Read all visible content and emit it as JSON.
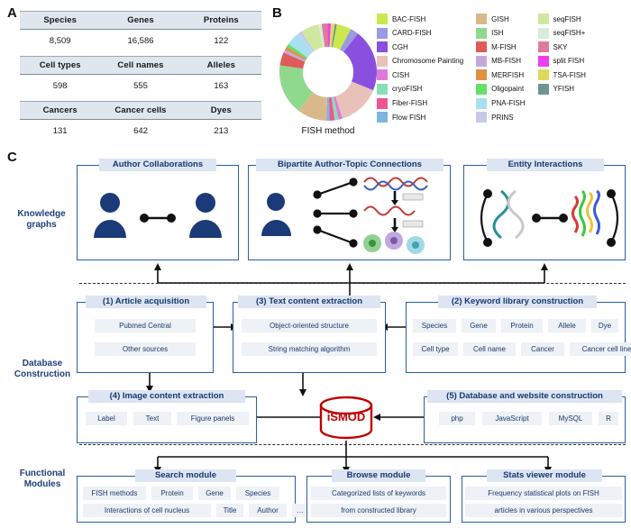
{
  "panels": {
    "a_letter": "A",
    "b_letter": "B",
    "c_letter": "C"
  },
  "panelA": {
    "blocks": [
      {
        "headers": [
          "Species",
          "Genes",
          "Proteins"
        ],
        "values": [
          "8,509",
          "16,586",
          "122"
        ]
      },
      {
        "headers": [
          "Cell types",
          "Cell names",
          "Alleles"
        ],
        "values": [
          "598",
          "555",
          "163"
        ]
      },
      {
        "headers": [
          "Cancers",
          "Cancer cells",
          "Dyes"
        ],
        "values": [
          "131",
          "642",
          "213"
        ]
      }
    ]
  },
  "panelB": {
    "caption": "FISH method",
    "legend_columns": [
      [
        {
          "label": "BAC-FISH",
          "color": "#cbe84e"
        },
        {
          "label": "CARD-FISH",
          "color": "#9a9ae0"
        },
        {
          "label": "CGH",
          "color": "#8b4fe0"
        },
        {
          "label": "Chromosome Painting",
          "color": "#e8c2b8"
        },
        {
          "label": "CISH",
          "color": "#e07ad8"
        },
        {
          "label": "cryoFISH",
          "color": "#86e0b4"
        },
        {
          "label": "Fiber-FISH",
          "color": "#ef5591"
        },
        {
          "label": "Flow FISH",
          "color": "#7fb4e0"
        }
      ],
      [
        {
          "label": "GISH",
          "color": "#d9b98a"
        },
        {
          "label": "ISH",
          "color": "#8ed98e"
        },
        {
          "label": "M-FISH",
          "color": "#e05a5a"
        },
        {
          "label": "MB-FISH",
          "color": "#c3a8e0"
        },
        {
          "label": "MERFISH",
          "color": "#e0913f"
        },
        {
          "label": "Oligopaint",
          "color": "#66e066"
        },
        {
          "label": "PNA-FISH",
          "color": "#a8e0ef"
        },
        {
          "label": "PRINS",
          "color": "#c8c8e8"
        }
      ],
      [
        {
          "label": "seqFISH",
          "color": "#cfe8a0"
        },
        {
          "label": "seqFISH+",
          "color": "#d8ecd8"
        },
        {
          "label": "SKY",
          "color": "#e07a9a"
        },
        {
          "label": "split FISH",
          "color": "#ef3fef"
        },
        {
          "label": "TSA-FISH",
          "color": "#e0d95a"
        },
        {
          "label": "YFISH",
          "color": "#6e9494"
        }
      ]
    ]
  },
  "chart_data": {
    "type": "pie",
    "title": "FISH method",
    "legend_position": "right",
    "categories": [
      "BAC-FISH",
      "CARD-FISH",
      "CGH",
      "Chromosome Painting",
      "CISH",
      "cryoFISH",
      "Fiber-FISH",
      "Flow FISH",
      "GISH",
      "ISH",
      "M-FISH",
      "MB-FISH",
      "MERFISH",
      "Oligopaint",
      "PNA-FISH",
      "PRINS",
      "seqFISH",
      "seqFISH+",
      "SKY",
      "split FISH",
      "TSA-FISH",
      "YFISH"
    ],
    "values": [
      4.5,
      2.5,
      19.0,
      13.0,
      1.2,
      1.2,
      1.5,
      1.0,
      9.0,
      15.5,
      4.0,
      1.0,
      1.0,
      1.0,
      4.5,
      1.0,
      5.5,
      1.0,
      1.8,
      1.0,
      1.2,
      0.6
    ],
    "colors": [
      "#cbe84e",
      "#9a9ae0",
      "#8b4fe0",
      "#e8c2b8",
      "#e07ad8",
      "#86e0b4",
      "#ef5591",
      "#7fb4e0",
      "#d9b98a",
      "#8ed98e",
      "#e05a5a",
      "#c3a8e0",
      "#e0913f",
      "#66e066",
      "#a8e0ef",
      "#c8c8e8",
      "#cfe8a0",
      "#d8ecd8",
      "#e07a9a",
      "#ef3fef",
      "#e0d95a",
      "#6e9494"
    ],
    "units": "percent of FISH articles",
    "donut_hole_ratio": 0.52
  },
  "panelC": {
    "row_labels": {
      "knowledge": "Knowledge\ngraphs",
      "database": "Database\nConstruction",
      "functional": "Functional\nModules"
    },
    "knowledge_graphs": [
      {
        "title": "Author Collaborations"
      },
      {
        "title": "Bipartite Author-Topic Connections"
      },
      {
        "title": "Entity Interactions"
      }
    ],
    "database": {
      "step1": {
        "title": "(1) Article acquisition",
        "chips": [
          "Pubmed Central",
          "Other sources"
        ]
      },
      "step3": {
        "title": "(3) Text content extraction",
        "chips": [
          "Object-oriented structure",
          "String matching algorithm"
        ]
      },
      "step2": {
        "title": "(2) Keyword library construction",
        "row1": [
          "Species",
          "Gene",
          "Protein",
          "Allele",
          "Dye"
        ],
        "row2": [
          "Cell type",
          "Cell name",
          "Cancer",
          "Cancer cell line"
        ]
      },
      "step4": {
        "title": "(4) Image content extraction",
        "chips": [
          "Label",
          "Text",
          "Figure panels"
        ]
      },
      "step5": {
        "title": "(5) Database and website construction",
        "chips": [
          "php",
          "JavaScript",
          "MySQL",
          "R"
        ]
      },
      "database_name": "iSMOD"
    },
    "functional_modules": [
      {
        "title": "Search module",
        "row1": [
          "FISH methods",
          "Protein",
          "Gene",
          "Species"
        ],
        "row2": [
          "Interactions of cell nucleus",
          "Title",
          "Author",
          "…"
        ]
      },
      {
        "title": "Browse module",
        "lines": [
          "Categorized lists of keywords",
          "from constructed library"
        ]
      },
      {
        "title": "Stats viewer module",
        "lines": [
          "Frequency statistical plots on FISH",
          "articles in various perspectives"
        ]
      }
    ]
  },
  "colors": {
    "box_border": "#2a5caa",
    "title_bg": "#dde5f2",
    "title_text": "#16396f",
    "chip_bg": "#eef1f5",
    "db_red": "#c00000",
    "person_blue": "#1b3a78",
    "table_header_bg": "#dfe6ee"
  }
}
